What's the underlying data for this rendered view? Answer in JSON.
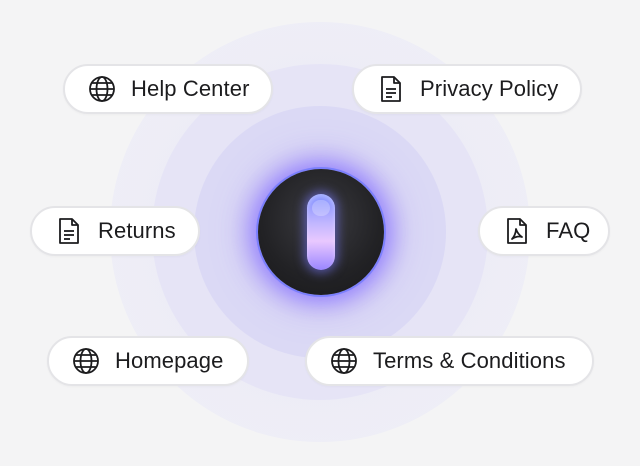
{
  "links": [
    {
      "label": "Help Center",
      "icon": "globe-icon"
    },
    {
      "label": "Privacy Policy",
      "icon": "document-icon"
    },
    {
      "label": "Returns",
      "icon": "document-icon"
    },
    {
      "label": "FAQ",
      "icon": "pdf-document-icon"
    },
    {
      "label": "Homepage",
      "icon": "globe-icon"
    },
    {
      "label": "Terms & Conditions",
      "icon": "globe-icon"
    }
  ],
  "colors": {
    "background": "#f4f4f5",
    "chip_border": "#e4e4e7",
    "core": "#222225",
    "accent_glow": "#8c6eff",
    "text": "#1c1c1e"
  }
}
